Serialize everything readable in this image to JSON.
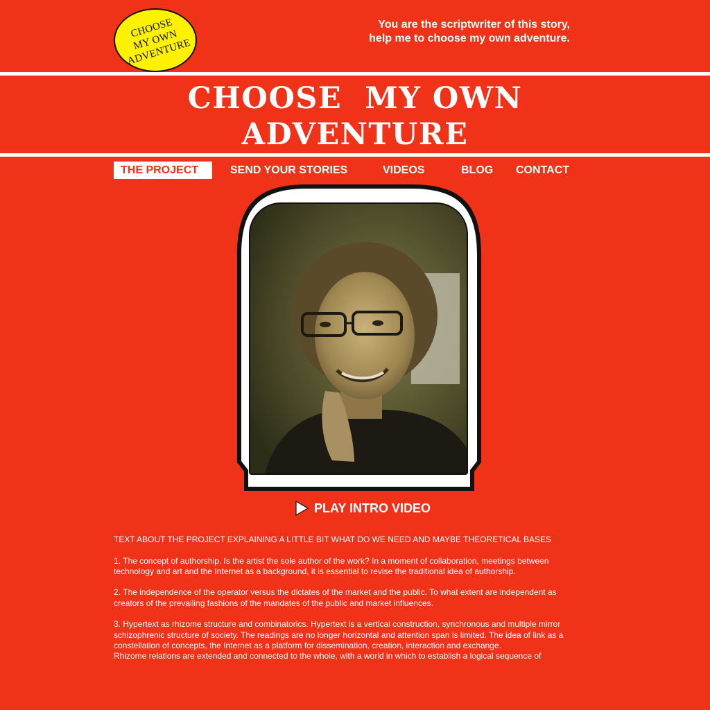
{
  "logo": {
    "lines": [
      "CHOOSE",
      "MY OWN",
      "ADVENTURE"
    ]
  },
  "header": {
    "tagline": "You are the scriptwriter of this story, help me to choose my own adventure.",
    "title_line1": "CHOOSE  MY OWN",
    "title_line2": "ADVENTURE"
  },
  "nav": {
    "items": [
      {
        "label": "THE PROJECT",
        "active": true
      },
      {
        "label": "SEND YOUR STORIES"
      },
      {
        "label": "VIDEOS"
      },
      {
        "label": "BLOG"
      },
      {
        "label": "CONTACT"
      }
    ]
  },
  "video": {
    "play_label": "PLAY INTRO VIDEO",
    "play_icon": "play-triangle-icon"
  },
  "content": {
    "intro": "TEXT ABOUT THE PROJECT EXPLAINING A LITTLE BIT WHAT DO WE NEED AND MAYBE THEORETICAL BASES",
    "point1": "1. The concept of authorship. Is the artist the sole author of the work? In a moment of collaboration, meetings between technology and art and the Internet as a background, it is essential to revise the traditional idea of authorship.",
    "point2": "2. The independence of the operator versus the dictates of the market and the public. To what extent are independent as creators of the prevailing fashions of the mandates of the public and market influences.",
    "point3": "3. Hypertext as rhizome structure and combinatorics. Hypertext is a vertical construction, synchronous and multiple mirror schizophrenic structure of society. The readings are no longer horizontal and attention span is limited. The idea of link as a constellation of concepts, the Internet as a platform for dissemination, creation, interaction and exchange.",
    "point3_cont": "Rhizome relations are extended and connected to the whole, with a world in which to establish a logical sequence of"
  },
  "colors": {
    "background": "#f03218",
    "accent": "#ffffff",
    "badge": "#fff200"
  }
}
